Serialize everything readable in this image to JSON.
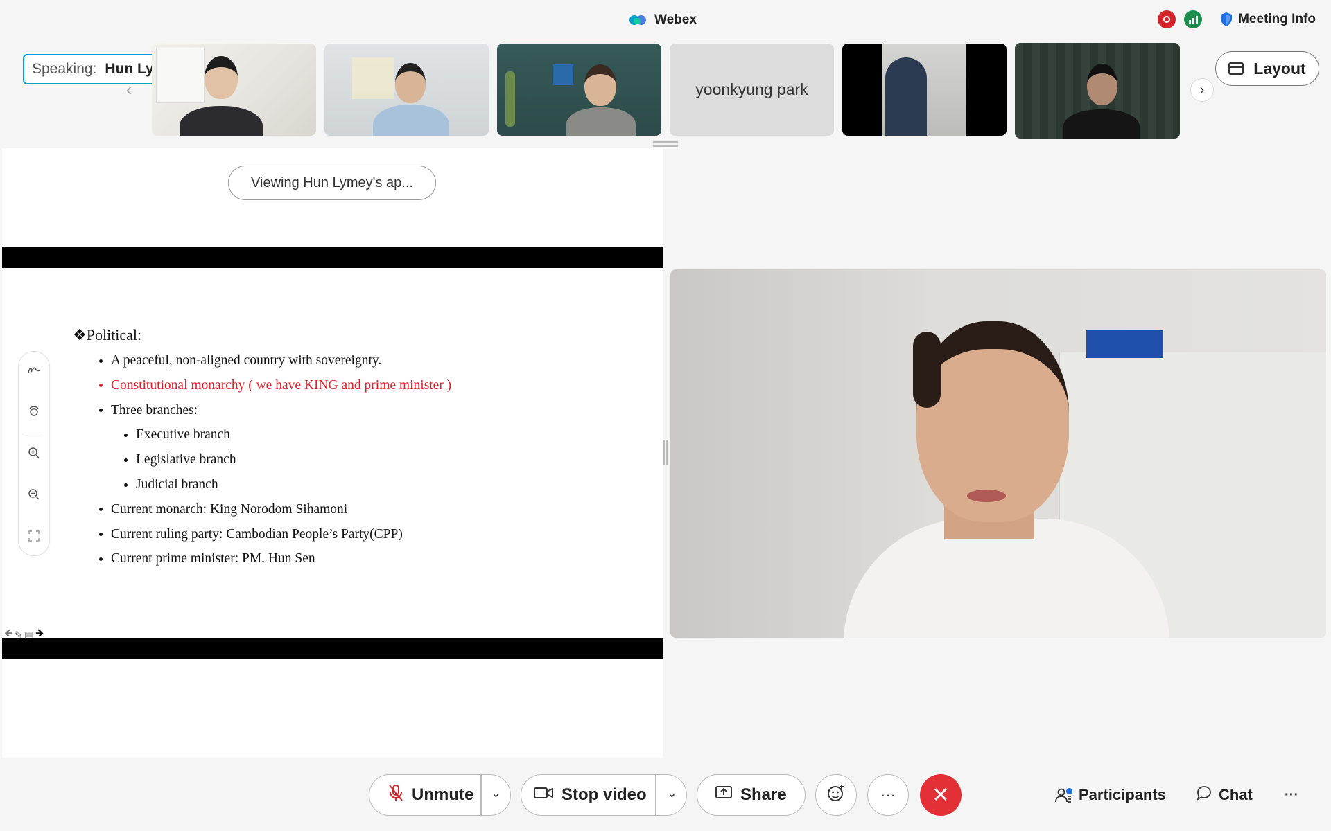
{
  "app": {
    "title": "Webex"
  },
  "header": {
    "meeting_info": "Meeting Info"
  },
  "filmstrip": {
    "speaking_key": "Speaking:",
    "speaking_name": "Hun Lymey",
    "prev_icon": "chevron-left-icon",
    "next_icon": "chevron-right-icon",
    "participants_no_video_name": "yoonkyung park",
    "layout_label": "Layout"
  },
  "share": {
    "viewing_label": "Viewing Hun Lymey's ap...",
    "slide": {
      "heading": "❖Political:",
      "items": [
        {
          "text": "A peaceful, non-aligned country with sovereignty.",
          "level": 1,
          "color": "#111111"
        },
        {
          "text": "Constitutional monarchy ( we have KING and prime minister )",
          "level": 1,
          "color": "#e0202a"
        },
        {
          "text": "Three branches:",
          "level": 1,
          "color": "#111111"
        },
        {
          "text": "Executive branch",
          "level": 2,
          "color": "#111111"
        },
        {
          "text": "Legislative branch",
          "level": 2,
          "color": "#111111"
        },
        {
          "text": "Judicial branch",
          "level": 2,
          "color": "#111111"
        },
        {
          "text": "Current monarch: King Norodom Sihamoni",
          "level": 1,
          "color": "#111111"
        },
        {
          "text": "Current ruling party: Cambodian People’s Party(CPP)",
          "level": 1,
          "color": "#111111"
        },
        {
          "text": "Current prime minister: PM. Hun Sen",
          "level": 1,
          "color": "#111111"
        }
      ]
    },
    "annotation_tools": [
      "annotate-icon",
      "remote-control-icon",
      "zoom-in-icon",
      "zoom-out-icon",
      "fit-screen-icon"
    ]
  },
  "toolbar": {
    "unmute": "Unmute",
    "stop_video": "Stop video",
    "share": "Share",
    "reactions_icon": "smiley-plus-icon",
    "more": "···",
    "leave_icon": "close-icon",
    "participants": "Participants",
    "chat": "Chat",
    "overflow": "···"
  },
  "colors": {
    "accent": "#00a0d1",
    "leave": "#e32f36",
    "record": "#d3262a",
    "stats": "#1b8e4e"
  }
}
